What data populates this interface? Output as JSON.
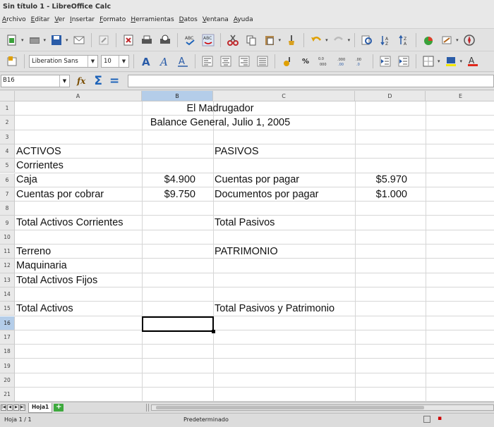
{
  "window": {
    "title": "Sin título 1 - LibreOffice Calc"
  },
  "menu": [
    "Archivo",
    "Editar",
    "Ver",
    "Insertar",
    "Formato",
    "Herramientas",
    "Datos",
    "Ventana",
    "Ayuda"
  ],
  "format_toolbar": {
    "font_name": "Liberation Sans",
    "font_size": "10",
    "percent_label": "%"
  },
  "formula_bar": {
    "cell_ref": "B16",
    "formula_value": ""
  },
  "columns": [
    "A",
    "B",
    "C",
    "D",
    "E"
  ],
  "rows": [
    "1",
    "2",
    "3",
    "4",
    "5",
    "6",
    "7",
    "8",
    "9",
    "10",
    "11",
    "12",
    "13",
    "14",
    "15",
    "16",
    "17",
    "18",
    "19",
    "20",
    "21"
  ],
  "cells": {
    "r1_title": "El Madrugador",
    "r2_subtitle": "Balance General, Julio 1, 2005",
    "r4_a": "ACTIVOS",
    "r4_c": "PASIVOS",
    "r5_a": "Corrientes",
    "r6_a": "Caja",
    "r6_b": "$4.900",
    "r6_c": "Cuentas por pagar",
    "r6_d": "$5.970",
    "r7_a": "Cuentas por cobrar",
    "r7_b": "$9.750",
    "r7_c": "Documentos por pagar",
    "r7_d": "$1.000",
    "r9_a": "Total Activos Corrientes",
    "r9_c": "Total Pasivos",
    "r11_a": "Terreno",
    "r11_c": "PATRIMONIO",
    "r12_a": "Maquinaria",
    "r13_a": "Total Activos Fijos",
    "r15_a": "Total Activos",
    "r15_c": "Total Pasivos y Patrimonio"
  },
  "sheet_tabs": [
    "Hoja1"
  ],
  "status": {
    "sheet_pos": "Hoja 1 / 1",
    "page_style": "Predeterminado"
  }
}
